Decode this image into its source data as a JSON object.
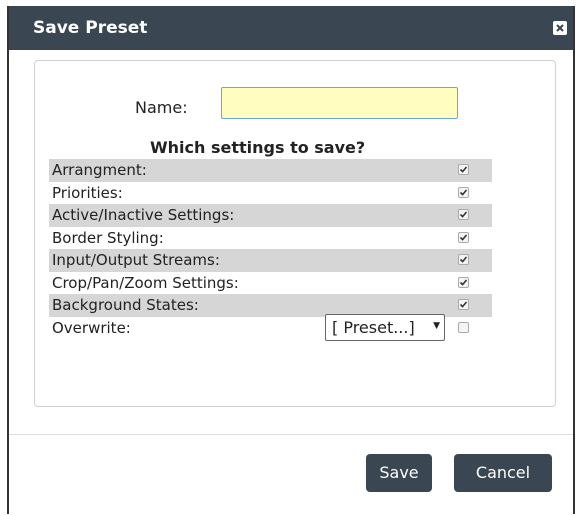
{
  "dialog": {
    "title": "Save Preset",
    "close_icon": "close-icon"
  },
  "form": {
    "name_label": "Name:",
    "name_value": "",
    "section_title": "Which settings to save?",
    "settings": [
      {
        "label": "Arrangment:",
        "checked": true
      },
      {
        "label": "Priorities:",
        "checked": true
      },
      {
        "label": "Active/Inactive Settings:",
        "checked": true
      },
      {
        "label": "Border Styling:",
        "checked": true
      },
      {
        "label": "Input/Output Streams:",
        "checked": true
      },
      {
        "label": "Crop/Pan/Zoom Settings:",
        "checked": true
      },
      {
        "label": "Background States:",
        "checked": true
      }
    ],
    "overwrite": {
      "label": "Overwrite:",
      "selected": "[ Preset...]",
      "checked": false
    }
  },
  "footer": {
    "save_label": "Save",
    "cancel_label": "Cancel"
  },
  "colors": {
    "titlebar": "#3a4651",
    "input_bg": "#fffdc0",
    "row_shade": "#d6d6d6"
  }
}
